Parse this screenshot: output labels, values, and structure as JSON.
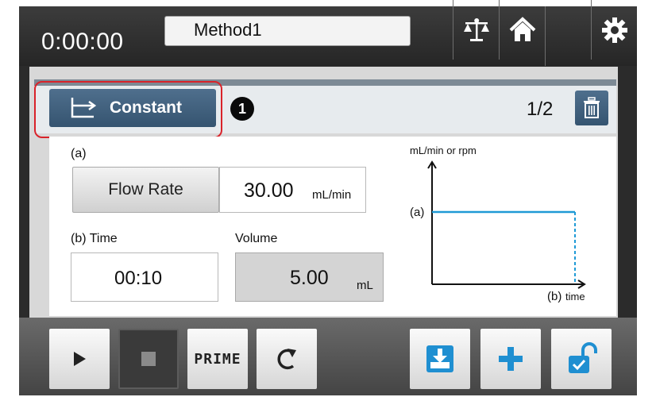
{
  "header": {
    "timer": "0:00:00",
    "method_name": "Method1",
    "buttons": [
      {
        "name": "balance-icon"
      },
      {
        "name": "home-icon"
      },
      {
        "name": "gear-icon"
      }
    ]
  },
  "segment": {
    "mode_label": "Constant",
    "mode_icon": "constant-profile-icon",
    "callout_number": "1",
    "page_indicator": "1/2",
    "delete_icon": "trash-icon"
  },
  "form": {
    "label_a": "(a)",
    "flow_rate_button": "Flow Rate",
    "flow_rate_value": "30.00",
    "flow_rate_unit": "mL/min",
    "label_b_time": "(b) Time",
    "label_volume": "Volume",
    "time_value": "00:10",
    "volume_value": "5.00",
    "volume_unit": "mL"
  },
  "chart_data": {
    "type": "line",
    "ylabel": "mL/min or rpm",
    "y_marker_label": "(a)",
    "x_marker_label": "(b)",
    "xlabel": "time",
    "series": [
      {
        "values": [
          "(a)",
          "(a)"
        ]
      }
    ]
  },
  "colors": {
    "accent_blue": "#355470",
    "chart_line": "#1f9ad6",
    "callout_red": "#d9232a",
    "toolbar_icon_blue": "#1f8fd1"
  },
  "toolbar": {
    "prime_label": "PRIME",
    "buttons": [
      {
        "name": "play-icon"
      },
      {
        "name": "stop-icon"
      },
      {
        "name": "prime-button"
      },
      {
        "name": "reset-icon"
      },
      {
        "name": "save-icon"
      },
      {
        "name": "plus-icon"
      },
      {
        "name": "unlock-icon"
      }
    ]
  }
}
